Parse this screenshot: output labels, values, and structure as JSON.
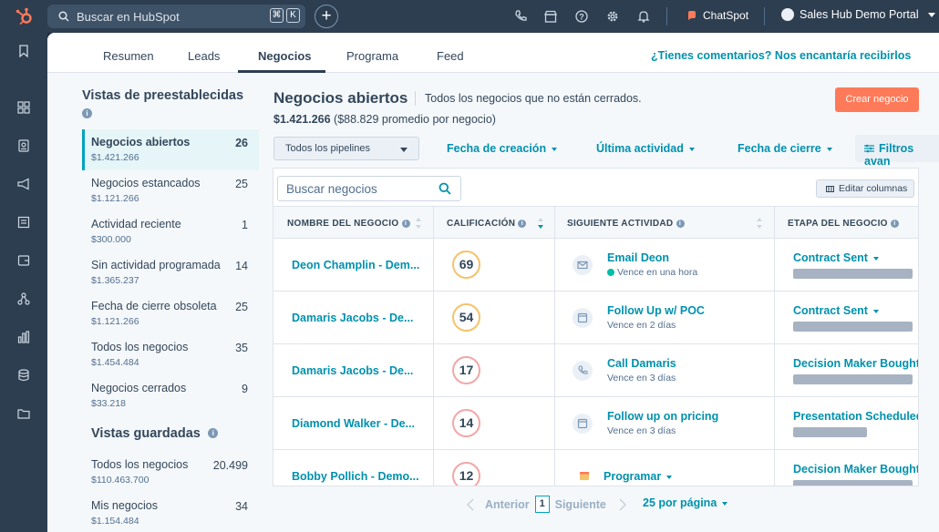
{
  "topbar": {
    "search_placeholder": "Buscar en HubSpot",
    "kbd": [
      "⌘",
      "K"
    ],
    "chatspot": "ChatSpot",
    "portal": "Sales Hub Demo Portal"
  },
  "tabs": [
    "Resumen",
    "Leads",
    "Negocios",
    "Programa",
    "Feed"
  ],
  "feedback_link": "¿Tienes comentarios? Nos encantaría recibirlos",
  "left_panel": {
    "preset_title": "Vistas de preestablecidas",
    "saved_title": "Vistas guardadas",
    "presets": [
      {
        "name": "Negocios abiertos",
        "amount": "$1.421.266",
        "count": "26"
      },
      {
        "name": "Negocios estancados",
        "amount": "$1.121.266",
        "count": "25"
      },
      {
        "name": "Actividad reciente",
        "amount": "$300.000",
        "count": "1"
      },
      {
        "name": "Sin actividad programada",
        "amount": "$1.365.237",
        "count": "14"
      },
      {
        "name": "Fecha de cierre obsoleta",
        "amount": "$1.121.266",
        "count": "25"
      },
      {
        "name": "Todos los negocios",
        "amount": "$1.454.484",
        "count": "35"
      },
      {
        "name": "Negocios cerrados",
        "amount": "$33.218",
        "count": "9"
      }
    ],
    "saved": [
      {
        "name": "Todos los negocios",
        "amount": "$110.463.700",
        "count": "20.499"
      },
      {
        "name": "Mis negocios",
        "amount": "$1.154.484",
        "count": "34"
      }
    ]
  },
  "main": {
    "title": "Negocios abiertos",
    "subtitle": "Todos los negocios que no están cerrados.",
    "total": "$1.421.266",
    "average": "($88.829 promedio por negocio)",
    "create_button": "Crear negocio",
    "pipeline_select": "Todos los pipelines",
    "filters": [
      "Fecha de creación",
      "Última actividad",
      "Fecha de cierre"
    ],
    "advanced_filters": "Filtros avan"
  },
  "table": {
    "search_placeholder": "Buscar negocios",
    "edit_columns": "Editar columnas",
    "columns": [
      "NOMBRE DEL NEGOCIO",
      "CALIFICACIÓN",
      "SIGUIENTE ACTIVIDAD",
      "ETAPA DEL NEGOCIO"
    ],
    "rows": [
      {
        "deal": "Deon Champlin - Dem...",
        "score": "69",
        "score_color": "#f5c26b",
        "activity": "Email Deon",
        "due": "Vence en una hora",
        "stage": "Contract Sent",
        "progress": 0.75
      },
      {
        "deal": "Damaris Jacobs - De...",
        "score": "54",
        "score_color": "#f5c26b",
        "activity": "Follow Up w/ POC",
        "due": "Vence en 2 días",
        "stage": "Contract Sent",
        "progress": 0.75
      },
      {
        "deal": "Damaris Jacobs - De...",
        "score": "17",
        "score_color": "#f2a7a7",
        "activity": "Call Damaris",
        "due": "Vence en 3 días",
        "stage": "Decision Maker Bought-",
        "progress": 0.75
      },
      {
        "deal": "Diamond Walker - De...",
        "score": "14",
        "score_color": "#f2a7a7",
        "activity": "Follow up on pricing",
        "due": "Vence en 3 días",
        "stage": "Presentation Scheduled",
        "progress": 0.46
      },
      {
        "deal": "Bobby Pollich - Demo...",
        "score": "12",
        "score_color": "#f2a7a7",
        "activity": "Programar",
        "due": "",
        "stage": "Decision Maker Bought-",
        "progress": 0.75
      }
    ]
  },
  "pagination": {
    "prev": "Anterior",
    "page": "1",
    "next": "Siguiente",
    "per_page": "25 por página"
  }
}
